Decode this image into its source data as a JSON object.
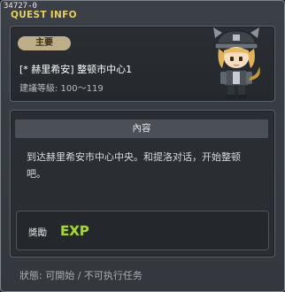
{
  "window": {
    "quest_id": "34727-0",
    "title": "QUEST INFO"
  },
  "quest": {
    "category_badge": "主要",
    "name": "[* 赫里希安] 整顿市中心1",
    "level_range": "建議等級: 100～119"
  },
  "content": {
    "section_title": "內容",
    "description_lines": [
      "到达赫里希安市中心中央。和提洛对话，开始整顿",
      "吧。"
    ]
  },
  "reward": {
    "label": "獎勵",
    "exp_text": "EXP"
  },
  "status": {
    "text": "狀態: 可開始 / 不可执行任务"
  },
  "colors": {
    "title": "#e6cf5f",
    "badge": "#bfae8a",
    "exp_fill": "#a6d636",
    "exp_outline": "#2f4a0a"
  },
  "icons": {
    "avatar": "character-avatar",
    "reward": "exp-icon"
  }
}
